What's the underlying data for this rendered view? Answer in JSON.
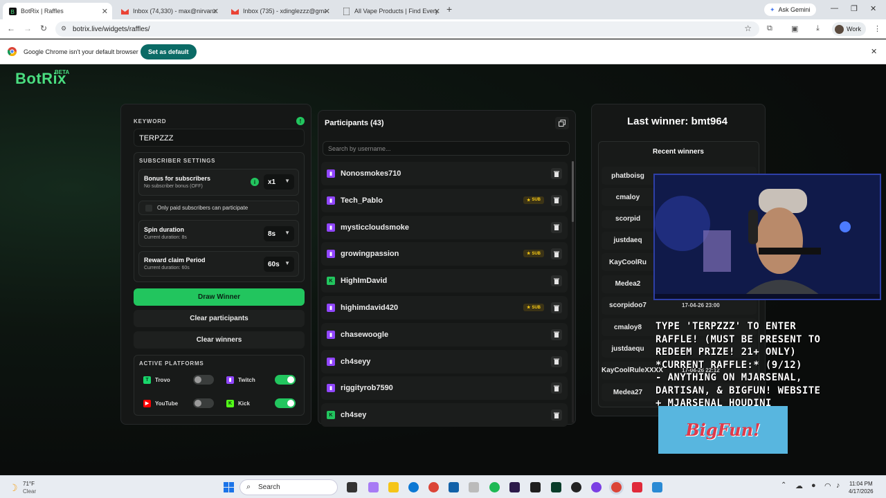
{
  "browser": {
    "tabs": [
      {
        "title": "BotRix | Raffles",
        "icon": "botrix-icon"
      },
      {
        "title": "Inbox (74,330) - max@nirvanac",
        "icon": "gmail-icon"
      },
      {
        "title": "Inbox (735) - xdinglezzz@gmai",
        "icon": "gmail-icon"
      },
      {
        "title": "All Vape Products | Find Every D",
        "icon": "doc-icon"
      }
    ],
    "ask_gemini": "Ask Gemini",
    "url": "botrix.live/widgets/raffles/",
    "profile": "Work",
    "infobar_text": "Google Chrome isn't your default browser",
    "set_default": "Set as default"
  },
  "app": {
    "logo": "BotRix",
    "beta": "BETA",
    "keyword_label": "KEYWORD",
    "keyword_value": "TERPZZZ",
    "subscriber_settings": "SUBSCRIBER SETTINGS",
    "bonus_title": "Bonus for subscribers",
    "bonus_sub": "No subscriber bonus (OFF)",
    "bonus_value": "x1",
    "only_paid": "Only paid subscribers can participate",
    "spin_title": "Spin duration",
    "spin_sub": "Current duration: 8s",
    "spin_value": "8s",
    "claim_title": "Reward claim Period",
    "claim_sub": "Current duration: 60s",
    "claim_value": "60s",
    "draw_winner": "Draw Winner",
    "clear_participants": "Clear participants",
    "clear_winners": "Clear winners",
    "active_platforms": "ACTIVE PLATFORMS",
    "platforms": [
      {
        "name": "Trovo",
        "enabled": false,
        "color": "#19d66b"
      },
      {
        "name": "Twitch",
        "enabled": true,
        "color": "#9146ff"
      },
      {
        "name": "YouTube",
        "enabled": false,
        "color": "#ff0000"
      },
      {
        "name": "Kick",
        "enabled": true,
        "color": "#53fc18"
      }
    ],
    "participants_title": "Participants (43)",
    "search_placeholder": "Search by username...",
    "participants": [
      {
        "name": "Nonosmokes710",
        "platform": "twitch",
        "sub": false
      },
      {
        "name": "Tech_Pablo",
        "platform": "twitch",
        "sub": true
      },
      {
        "name": "mysticcloudsmoke",
        "platform": "twitch",
        "sub": false
      },
      {
        "name": "growingpassion",
        "platform": "twitch",
        "sub": true
      },
      {
        "name": "HighImDavid",
        "platform": "kick",
        "sub": false
      },
      {
        "name": "highimdavid420",
        "platform": "twitch",
        "sub": true
      },
      {
        "name": "chasewoogle",
        "platform": "twitch",
        "sub": false
      },
      {
        "name": "ch4seyy",
        "platform": "twitch",
        "sub": false
      },
      {
        "name": "riggityrob7590",
        "platform": "twitch",
        "sub": false
      },
      {
        "name": "ch4sey",
        "platform": "kick",
        "sub": false
      }
    ],
    "sub_badge": "SUB",
    "last_winner": "Last winner: bmt964",
    "recent_winners_title": "Recent winners",
    "recent_winners": [
      {
        "name": "phatboisg",
        "date": ""
      },
      {
        "name": "cmaloy",
        "date": ""
      },
      {
        "name": "scorpid",
        "date": ""
      },
      {
        "name": "justdaeq",
        "date": ""
      },
      {
        "name": "KayCoolRu",
        "date": ""
      },
      {
        "name": "Medea2",
        "date": ""
      },
      {
        "name": "scorpidoo7",
        "date": "17-04-26 23:00"
      },
      {
        "name": "cmaloy8",
        "date": ""
      },
      {
        "name": "justdaequ",
        "date": ""
      },
      {
        "name": "KayCoolRuleXXXX",
        "date": "17-04-26 22:12"
      },
      {
        "name": "Medea27",
        "date": ""
      }
    ]
  },
  "overlay": {
    "lines": [
      "Type 'TERPZZZ' to enter",
      "raffle! (Must be present to",
      "redeem prize! 21+ only)",
      "*Current Raffle:* (9/12)",
      "- Anything on MJArsenal,",
      "Dartisan, & BigFun! website",
      "+ MJArsenal Houdini"
    ],
    "bigfun": "BigFun!"
  },
  "taskbar": {
    "temp": "71°F",
    "weather": "Clear",
    "search": "Search",
    "time": "11:04 PM",
    "date": "4/17/2026"
  }
}
